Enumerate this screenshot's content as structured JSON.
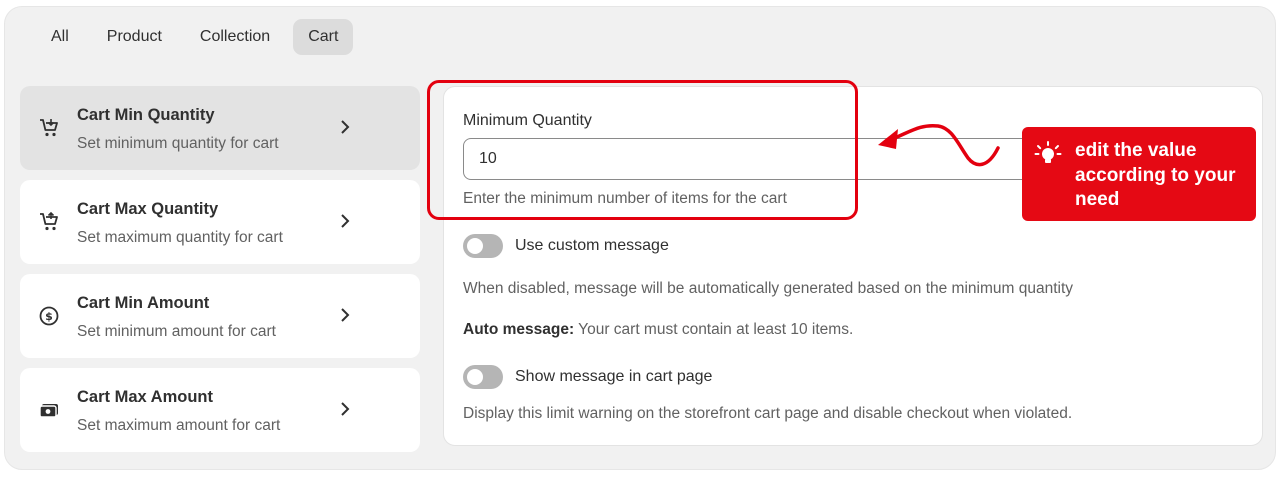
{
  "tabs": [
    {
      "label": "All",
      "active": false
    },
    {
      "label": "Product",
      "active": false
    },
    {
      "label": "Collection",
      "active": false
    },
    {
      "label": "Cart",
      "active": true
    }
  ],
  "sidebar": {
    "items": [
      {
        "title": "Cart Min Quantity",
        "desc": "Set minimum quantity for cart",
        "icon": "cart-minus-icon",
        "active": true
      },
      {
        "title": "Cart Max Quantity",
        "desc": "Set maximum quantity for cart",
        "icon": "cart-plus-icon",
        "active": false
      },
      {
        "title": "Cart Min Amount",
        "desc": "Set minimum amount for cart",
        "icon": "dollar-circle-icon",
        "active": false
      },
      {
        "title": "Cart Max Amount",
        "desc": "Set maximum amount for cart",
        "icon": "cash-icon",
        "active": false
      }
    ]
  },
  "form": {
    "min_qty_label": "Minimum Quantity",
    "min_qty_value": "10",
    "min_qty_help": "Enter the minimum number of items for the cart",
    "custom_message_label": "Use custom message",
    "custom_message_enabled": false,
    "disabled_help": "When disabled, message will be automatically generated based on the minimum quantity",
    "auto_message_label": "Auto message:",
    "auto_message_text": "Your cart must contain at least 10 items.",
    "show_in_cart_label": "Show message in cart page",
    "show_in_cart_enabled": false,
    "show_in_cart_help": "Display this limit warning on the storefront cart page and disable checkout when violated."
  },
  "annotation": {
    "callout_text": "edit the value according to your need",
    "color": "#e50914"
  }
}
